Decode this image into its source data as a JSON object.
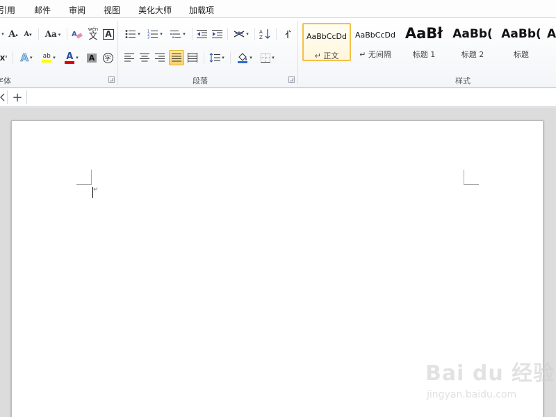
{
  "menu": {
    "tabs": [
      "引用",
      "邮件",
      "审阅",
      "视图",
      "美化大师",
      "加载项"
    ]
  },
  "ribbon": {
    "font_group_label": "字体",
    "paragraph_group_label": "段落",
    "styles_group_label": "样式",
    "font_buttons": {
      "grow_font": "A",
      "shrink_font": "A",
      "change_case": "Aa",
      "phonetic_guide": "wén",
      "char_border": "A",
      "text_effects": "A",
      "highlight": "ab",
      "font_color": "A",
      "char_shading": "A",
      "enclose_char": "字"
    },
    "styles": [
      {
        "preview": "AaBbCcDd",
        "name": "↵ 正文"
      },
      {
        "preview": "AaBbCcDd",
        "name": "↵ 无间隔"
      },
      {
        "preview": "AaBł",
        "name": "标题 1"
      },
      {
        "preview": "AaBb(",
        "name": "标题 2"
      },
      {
        "preview": "AaBb(",
        "name": "标题"
      },
      {
        "preview": "A",
        "name": ""
      }
    ]
  },
  "doc_tabs": {
    "new_tab": "+"
  },
  "document": {
    "paragraph_mark": "↵"
  },
  "watermark": {
    "logo": "Bai du 经验",
    "url": "jingyan.baidu.com"
  },
  "colors": {
    "highlight": "#ffff00",
    "font_color": "#e00000",
    "selected_style_border": "#f3c046"
  }
}
